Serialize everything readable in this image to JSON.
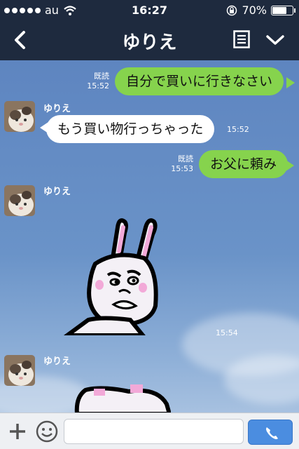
{
  "status": {
    "carrier": "au",
    "time": "16:27",
    "battery": "70%",
    "battery_level": 0.7
  },
  "nav": {
    "title": "ゆりえ"
  },
  "messages": [
    {
      "side": "right",
      "text": "自分で買いに行きなさい",
      "read": "既読",
      "time": "15:52"
    },
    {
      "side": "left",
      "sender": "ゆりえ",
      "text": "もう買い物行っちゃった",
      "time": "15:52"
    },
    {
      "side": "right",
      "text": "お父に頼み",
      "read": "既読",
      "time": "15:53"
    },
    {
      "side": "left",
      "sender": "ゆりえ",
      "sticker": "rabbit-sticker",
      "time": "15:54"
    },
    {
      "side": "left",
      "sender": "ゆりえ",
      "sticker": "rabbit-sticker"
    }
  ],
  "input": {
    "placeholder": "",
    "value": ""
  },
  "colors": {
    "nav_bg": "#1e2a3e",
    "sent_bubble": "#86d34d",
    "received_bubble": "#ffffff",
    "call_button": "#4b8de0"
  },
  "icons": [
    "back-icon",
    "list-icon",
    "chevron-down-icon",
    "plus-icon",
    "emoji-icon",
    "phone-icon",
    "wifi-icon",
    "rotation-lock-icon",
    "battery-icon"
  ]
}
